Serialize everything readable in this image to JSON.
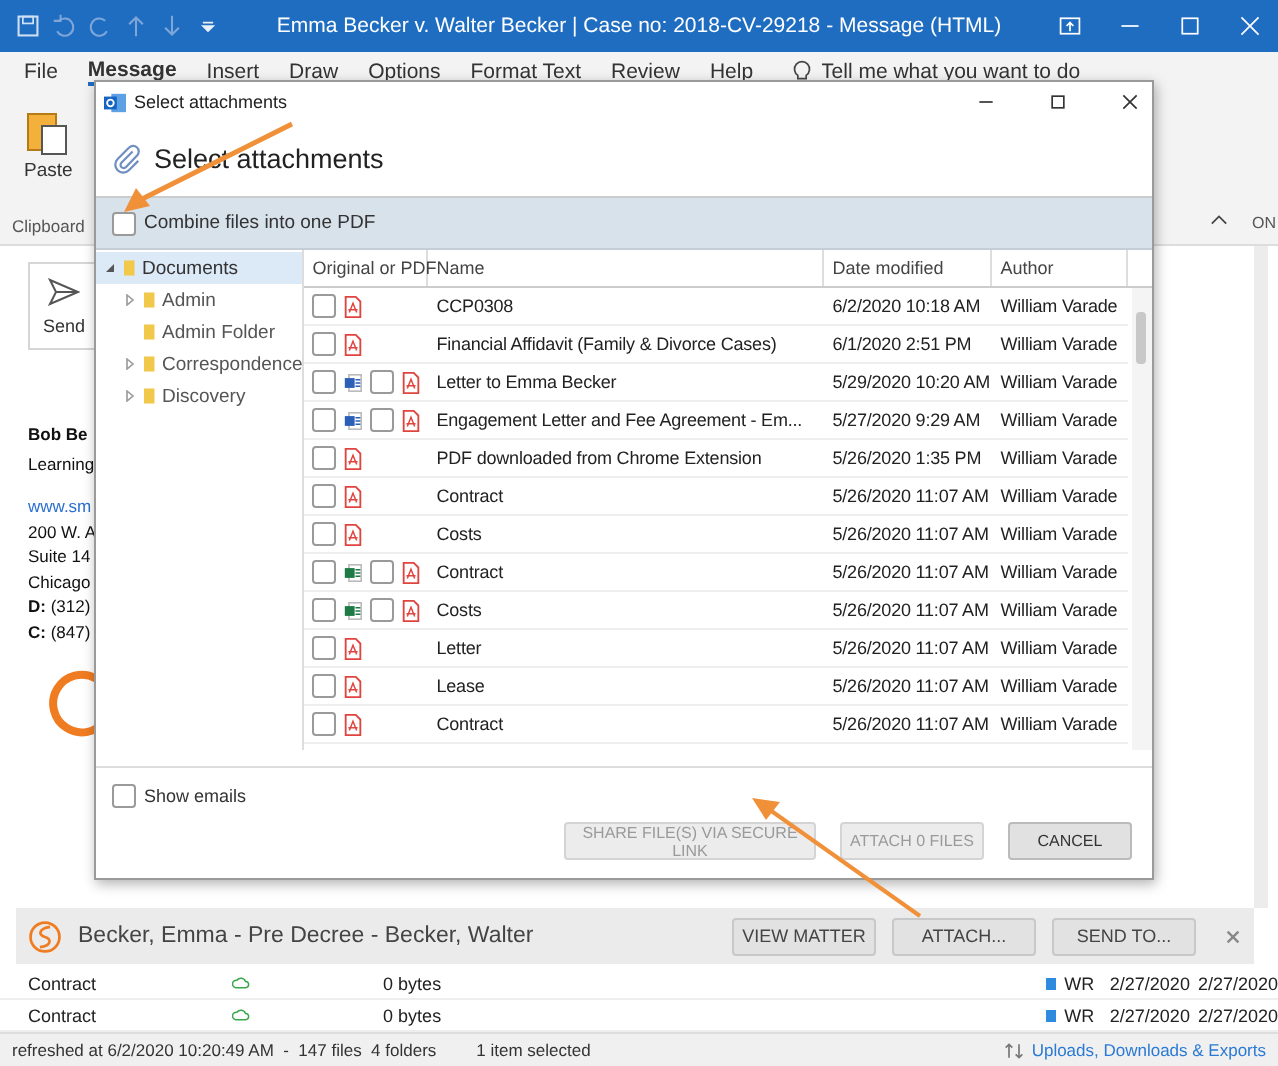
{
  "window": {
    "title": "Emma Becker v. Walter Becker | Case no: 2018-CV-29218  -  Message (HTML)"
  },
  "menu": [
    {
      "label": "File",
      "selected": false
    },
    {
      "label": "Message",
      "selected": true
    },
    {
      "label": "Insert",
      "selected": false
    },
    {
      "label": "Draw",
      "selected": false
    },
    {
      "label": "Options",
      "selected": false
    },
    {
      "label": "Format Text",
      "selected": false
    },
    {
      "label": "Review",
      "selected": false
    },
    {
      "label": "Help",
      "selected": false
    }
  ],
  "tell_me": {
    "placeholder": "Tell me what you want to do"
  },
  "ribbon": {
    "paste_label": "Paste",
    "group_label": "Clipboard",
    "edge_label": "ON"
  },
  "send_button": "Send",
  "signature": {
    "name": "Bob Be",
    "title": "Learning",
    "link": "www.sm",
    "lines": [
      "200 W. A",
      "Suite 14",
      "Chicago"
    ],
    "phones": [
      {
        "label": "D:",
        "value": " (312)"
      },
      {
        "label": "C:",
        "value": " (847)"
      }
    ]
  },
  "dialog": {
    "title": "Select attachments",
    "heading": "Select attachments",
    "combine": {
      "label": "Combine files into one PDF",
      "checked": false
    },
    "tree": [
      {
        "label": "Documents",
        "expanded": true,
        "selected": true,
        "children": [
          {
            "label": "Admin",
            "expanded": false,
            "selected": false
          },
          {
            "label": "Admin Folder",
            "selected": false
          },
          {
            "label": "Correspondence",
            "expanded": false,
            "selected": false
          },
          {
            "label": "Discovery",
            "expanded": false,
            "selected": false
          }
        ]
      }
    ],
    "columns": [
      "Original or PDF",
      "Name",
      "Date modified",
      "Author"
    ],
    "rows": [
      {
        "options": [
          {
            "kind": "pdf",
            "checked": false
          }
        ],
        "name": "CCP0308",
        "date": "6/2/2020 10:18 AM",
        "author": "William Varade"
      },
      {
        "options": [
          {
            "kind": "pdf",
            "checked": false
          }
        ],
        "name": "Financial Affidavit (Family & Divorce Cases)",
        "date": "6/1/2020 2:51 PM",
        "author": "William Varade"
      },
      {
        "options": [
          {
            "kind": "word",
            "checked": false
          },
          {
            "kind": "pdf",
            "checked": false
          }
        ],
        "name": "Letter to Emma Becker",
        "date": "5/29/2020 10:20 AM",
        "author": "William Varade"
      },
      {
        "options": [
          {
            "kind": "word",
            "checked": false
          },
          {
            "kind": "pdf",
            "checked": false
          }
        ],
        "name": "Engagement Letter and Fee Agreement - Em...",
        "date": "5/27/2020 9:29 AM",
        "author": "William Varade"
      },
      {
        "options": [
          {
            "kind": "pdf",
            "checked": false
          }
        ],
        "name": "PDF downloaded from Chrome Extension",
        "date": "5/26/2020 1:35 PM",
        "author": "William Varade"
      },
      {
        "options": [
          {
            "kind": "pdf",
            "checked": false
          }
        ],
        "name": "Contract",
        "date": "5/26/2020 11:07 AM",
        "author": "William Varade"
      },
      {
        "options": [
          {
            "kind": "pdf",
            "checked": false
          }
        ],
        "name": "Costs",
        "date": "5/26/2020 11:07 AM",
        "author": "William Varade"
      },
      {
        "options": [
          {
            "kind": "excel",
            "checked": false
          },
          {
            "kind": "pdf",
            "checked": false
          }
        ],
        "name": "Contract",
        "date": "5/26/2020 11:07 AM",
        "author": "William Varade"
      },
      {
        "options": [
          {
            "kind": "excel",
            "checked": false
          },
          {
            "kind": "pdf",
            "checked": false
          }
        ],
        "name": "Costs",
        "date": "5/26/2020 11:07 AM",
        "author": "William Varade"
      },
      {
        "options": [
          {
            "kind": "pdf",
            "checked": false
          }
        ],
        "name": "Letter",
        "date": "5/26/2020 11:07 AM",
        "author": "William Varade"
      },
      {
        "options": [
          {
            "kind": "pdf",
            "checked": false
          }
        ],
        "name": "Lease",
        "date": "5/26/2020 11:07 AM",
        "author": "William Varade"
      },
      {
        "options": [
          {
            "kind": "pdf",
            "checked": false
          }
        ],
        "name": "Contract",
        "date": "5/26/2020 11:07 AM",
        "author": "William Varade"
      }
    ],
    "show_emails": {
      "label": "Show emails",
      "checked": false
    },
    "buttons": [
      {
        "label": "SHARE FILE(S) VIA SECURE LINK",
        "disabled": true
      },
      {
        "label": "ATTACH 0 FILES",
        "disabled": true
      },
      {
        "label": "CANCEL",
        "disabled": false
      }
    ]
  },
  "matter_bar": {
    "title": "Becker, Emma - Pre Decree - Becker, Walter",
    "buttons": [
      "VIEW MATTER",
      "ATTACH...",
      "SEND TO..."
    ]
  },
  "file_rows": [
    {
      "name": "Contract",
      "size": "0 bytes",
      "tag": "WR",
      "color": "#2f8be0",
      "created": "2/27/2020",
      "modified": "2/27/2020"
    },
    {
      "name": "Contract",
      "size": "0 bytes",
      "tag": "WR",
      "color": "#2f8be0",
      "created": "2/27/2020",
      "modified": "2/27/2020"
    }
  ],
  "status_bar": {
    "summary": "refreshed at 6/2/2020 10:20:49 AM  -  147 files  4 folders",
    "selection": "1 item selected",
    "link": "Uploads, Downloads & Exports"
  }
}
